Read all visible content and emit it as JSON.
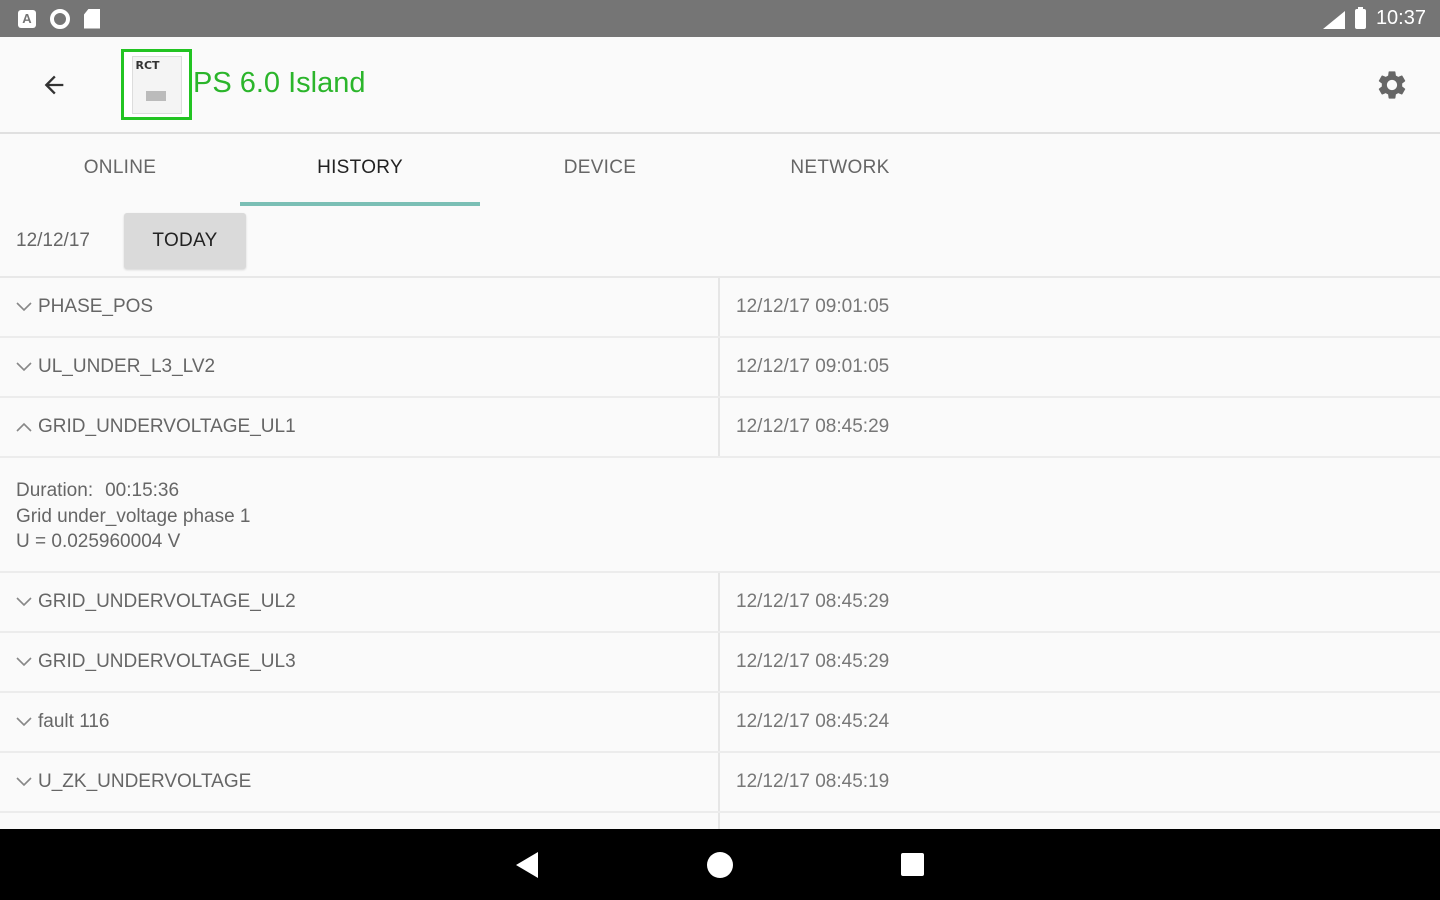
{
  "status_bar": {
    "time": "10:37",
    "icons": [
      "a-notification-icon",
      "circle-notification-icon",
      "sd-card-icon",
      "signal-icon",
      "battery-icon"
    ]
  },
  "app_bar": {
    "title": "PS 6.0 Island",
    "logo_text": "RCT",
    "title_color": "#2bb52b",
    "logo_border_color": "#22c422"
  },
  "tabs": [
    {
      "label": "ONLINE",
      "active": false
    },
    {
      "label": "HISTORY",
      "active": true
    },
    {
      "label": "DEVICE",
      "active": false
    },
    {
      "label": "NETWORK",
      "active": false
    }
  ],
  "tab_indicator_color": "#7bbfb5",
  "date_bar": {
    "date": "12/12/17",
    "today_label": "TODAY"
  },
  "events": [
    {
      "name": "PHASE_POS",
      "time": "12/12/17 09:01:05",
      "expanded": false
    },
    {
      "name": "UL_UNDER_L3_LV2",
      "time": "12/12/17 09:01:05",
      "expanded": false
    },
    {
      "name": "GRID_UNDERVOLTAGE_UL1",
      "time": "12/12/17 08:45:29",
      "expanded": true
    },
    {
      "name": "GRID_UNDERVOLTAGE_UL2",
      "time": "12/12/17 08:45:29",
      "expanded": false
    },
    {
      "name": "GRID_UNDERVOLTAGE_UL3",
      "time": "12/12/17 08:45:29",
      "expanded": false
    },
    {
      "name": "fault 116",
      "time": "12/12/17 08:45:24",
      "expanded": false
    },
    {
      "name": "U_ZK_UNDERVOLTAGE",
      "time": "12/12/17 08:45:19",
      "expanded": false
    }
  ],
  "expanded_details": {
    "duration_label": "Duration:",
    "duration_value": "00:15:36",
    "description": "Grid under_voltage phase 1",
    "value_line": "U = 0.025960004 V"
  }
}
